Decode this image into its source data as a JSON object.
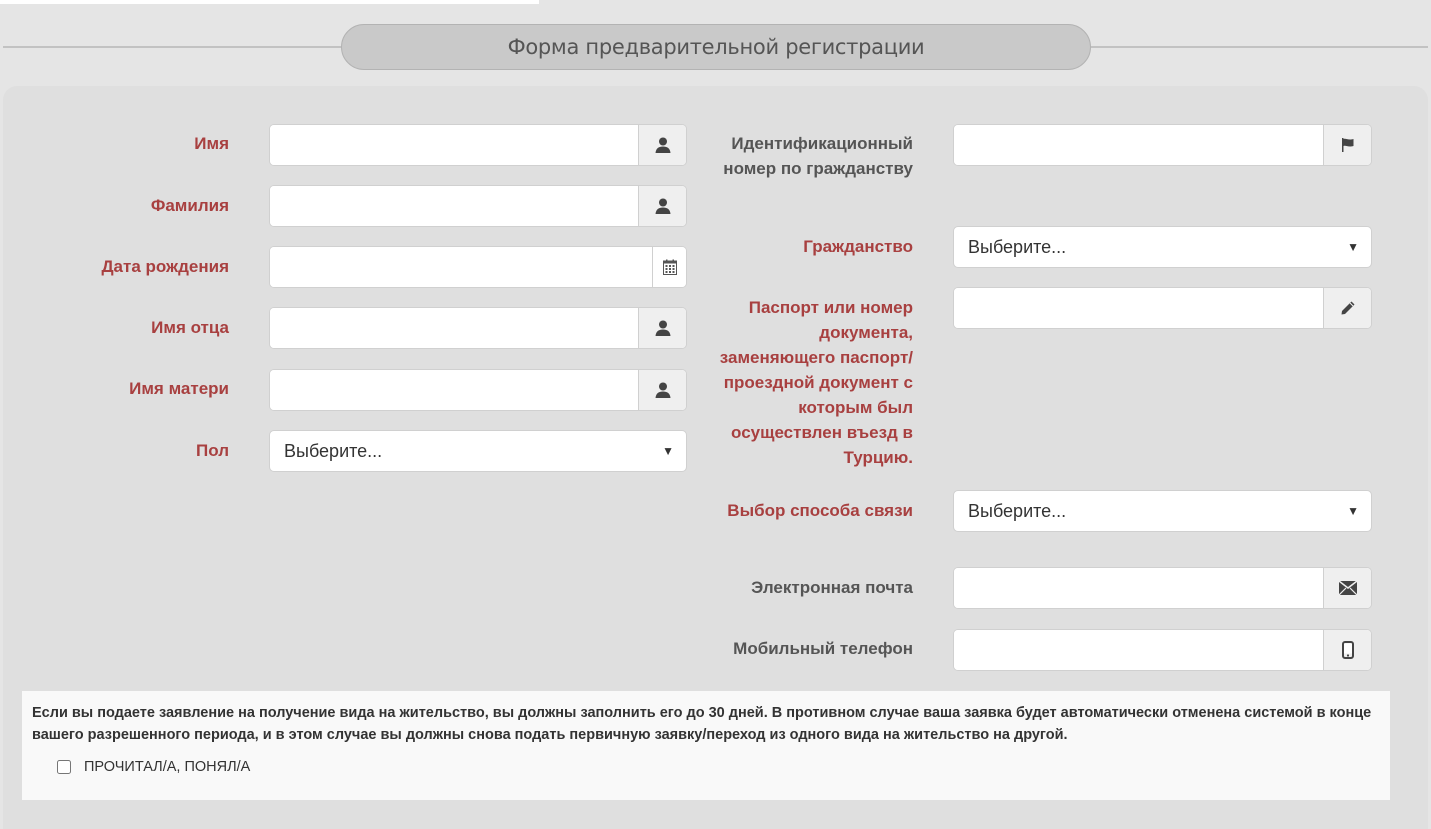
{
  "header": {
    "title": "Форма предварительной регистрации"
  },
  "left_column": {
    "fields": [
      {
        "label": "Имя",
        "value": "",
        "icon": "user-icon",
        "required": true
      },
      {
        "label": "Фамилия",
        "value": "",
        "icon": "user-icon",
        "required": true
      },
      {
        "label": "Дата рождения",
        "value": "",
        "icon": "calendar-icon",
        "required": true
      },
      {
        "label": "Имя отца",
        "value": "",
        "icon": "user-icon",
        "required": true
      },
      {
        "label": "Имя матери",
        "value": "",
        "icon": "user-icon",
        "required": true
      }
    ],
    "gender": {
      "label": "Пол",
      "selected": "Выберите...",
      "required": true
    }
  },
  "right_column": {
    "national_id": {
      "label": "Идентификационный номер по гражданству",
      "value": "",
      "icon": "flag-icon",
      "required": false
    },
    "citizenship": {
      "label": "Гражданство",
      "selected": "Выберите...",
      "required": true
    },
    "passport": {
      "label": "Паспорт или номер документа, заменяющего паспорт/ проездной документ с которым был осуществлен въезд в Турцию.",
      "value": "",
      "icon": "pencil-icon",
      "required": true
    },
    "contact_method": {
      "label": "Выбор способа связи",
      "selected": "Выберите...",
      "required": true
    },
    "email": {
      "label": "Электронная почта",
      "value": "",
      "icon": "envelope-icon",
      "required": false
    },
    "mobile": {
      "label": "Мобильный телефон",
      "value": "",
      "icon": "mobile-phone-icon",
      "required": false
    }
  },
  "notice": {
    "text": "Если вы подаете заявление на получение вида на жительство, вы должны заполнить его до 30 дней. В противном случае ваша заявка будет автоматически отменена системой в конце вашего разрешенного периода, и в этом случае вы должны снова подать первичную заявку/переход из одного вида на жительство на другой.",
    "checkbox_label": "ПРОЧИТАЛ/А, ПОНЯЛ/А",
    "checked": false
  },
  "colors": {
    "required_label": "#a84040",
    "optional_label": "#555555",
    "panel_bg": "#dfdfdf",
    "page_bg": "#e5e5e5",
    "title_pill_bg": "#c9c9c9"
  }
}
